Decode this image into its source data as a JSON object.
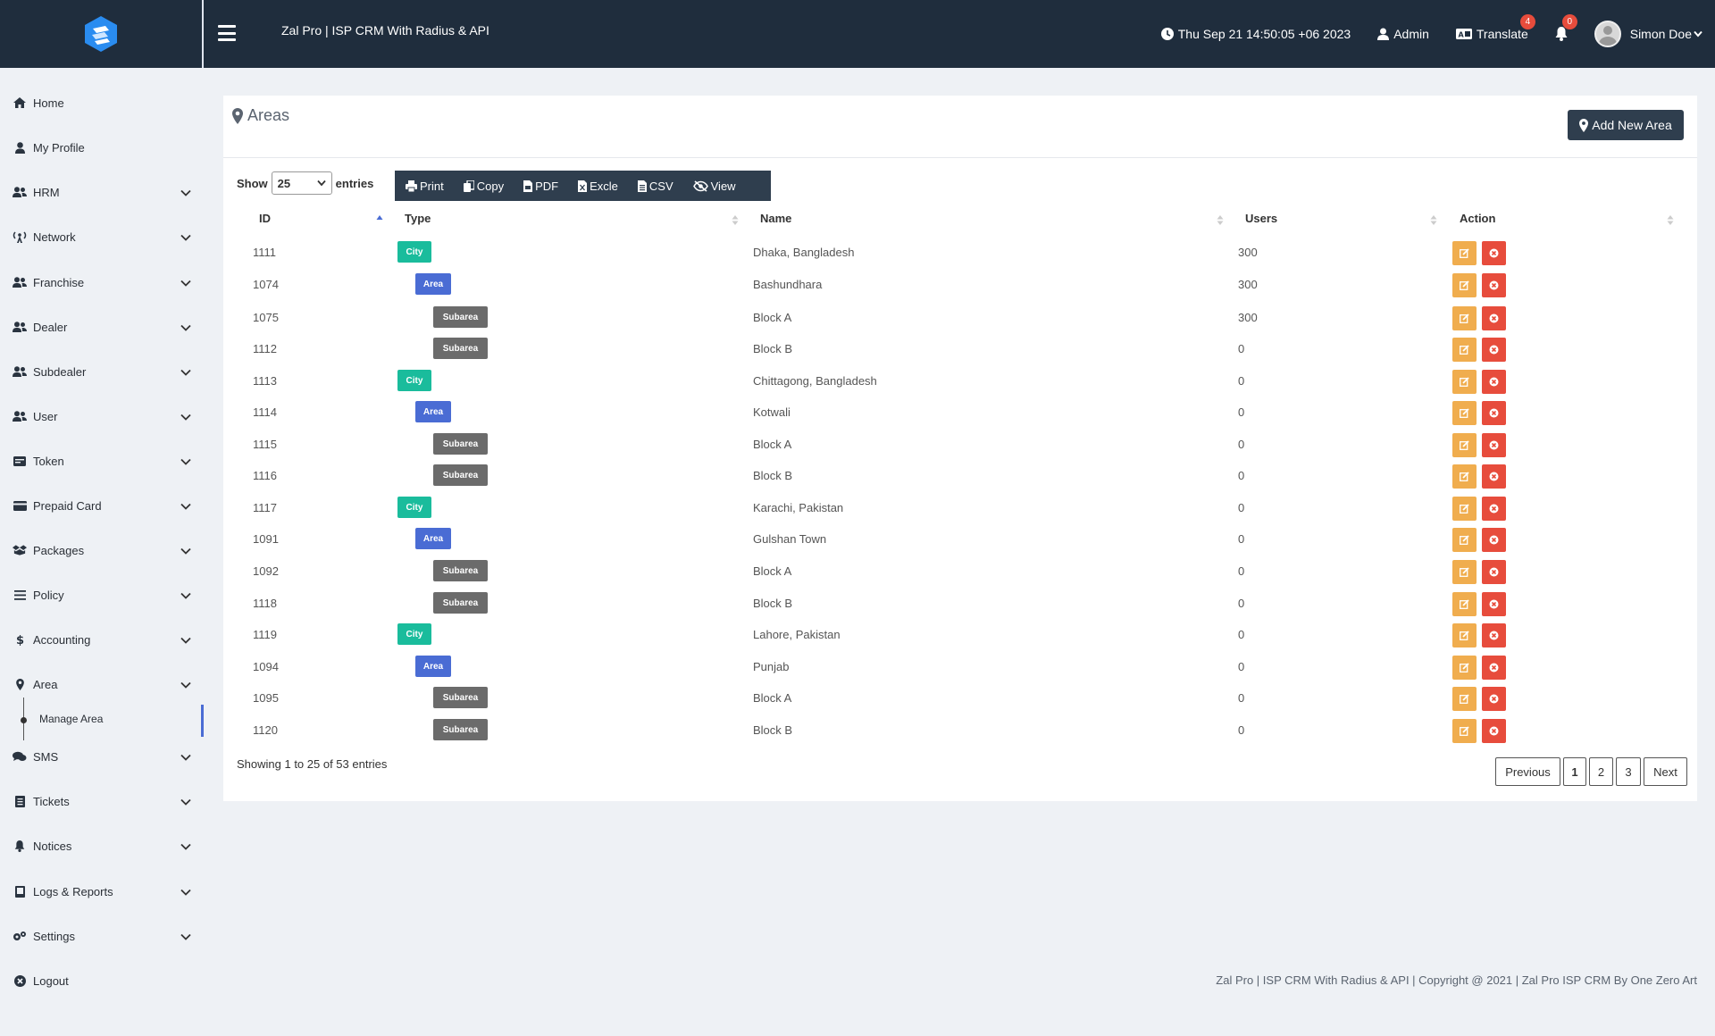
{
  "header": {
    "app_title": "Zal Pro | ISP CRM With Radius & API",
    "datetime": "Thu Sep 21 14:50:05 +06 2023",
    "admin_label": "Admin",
    "translate_label": "Translate",
    "translate_badge": "4",
    "notification_badge": "0",
    "user_name": "Simon Doe"
  },
  "sidebar": {
    "items": [
      {
        "label": "Home",
        "icon": "home-icon",
        "chevron": false
      },
      {
        "label": "My Profile",
        "icon": "user-icon",
        "chevron": false
      },
      {
        "label": "HRM",
        "icon": "users-icon",
        "chevron": true
      },
      {
        "label": "Network",
        "icon": "antenna-icon",
        "chevron": true
      },
      {
        "label": "Franchise",
        "icon": "users-icon",
        "chevron": true
      },
      {
        "label": "Dealer",
        "icon": "users-icon",
        "chevron": true
      },
      {
        "label": "Subdealer",
        "icon": "users-icon",
        "chevron": true
      },
      {
        "label": "User",
        "icon": "users-icon",
        "chevron": true
      },
      {
        "label": "Token",
        "icon": "token-icon",
        "chevron": true
      },
      {
        "label": "Prepaid Card",
        "icon": "card-icon",
        "chevron": true
      },
      {
        "label": "Packages",
        "icon": "packages-icon",
        "chevron": true
      },
      {
        "label": "Policy",
        "icon": "list-icon",
        "chevron": true
      },
      {
        "label": "Accounting",
        "icon": "dollar-icon",
        "chevron": true
      },
      {
        "label": "Area",
        "icon": "map-marker-icon",
        "chevron": true
      },
      {
        "label": "SMS",
        "icon": "comments-icon",
        "chevron": true
      },
      {
        "label": "Tickets",
        "icon": "ticket-icon",
        "chevron": true
      },
      {
        "label": "Notices",
        "icon": "bell-icon",
        "chevron": true
      },
      {
        "label": "Logs & Reports",
        "icon": "book-icon",
        "chevron": true
      },
      {
        "label": "Settings",
        "icon": "gears-icon",
        "chevron": true
      },
      {
        "label": "Logout",
        "icon": "logout-icon",
        "chevron": false
      }
    ],
    "active_sub": "Manage Area"
  },
  "page": {
    "title": "Areas",
    "add_button": "Add New Area",
    "show_label": "Show",
    "entries_label": "entries",
    "page_length": "25",
    "toolbar": [
      "Print",
      "Copy",
      "PDF",
      "Excle",
      "CSV",
      "View"
    ]
  },
  "table": {
    "headers": [
      "ID",
      "Type",
      "Name",
      "Users",
      "Action"
    ],
    "rows": [
      {
        "id": "1111",
        "type": "City",
        "name": "Dhaka, Bangladesh",
        "users": "300"
      },
      {
        "id": "1074",
        "type": "Area",
        "name": "Bashundhara",
        "users": "300"
      },
      {
        "id": "1075",
        "type": "Subarea",
        "name": "Block A",
        "users": "300"
      },
      {
        "id": "1112",
        "type": "Subarea",
        "name": "Block B",
        "users": "0"
      },
      {
        "id": "1113",
        "type": "City",
        "name": "Chittagong, Bangladesh",
        "users": "0"
      },
      {
        "id": "1114",
        "type": "Area",
        "name": "Kotwali",
        "users": "0"
      },
      {
        "id": "1115",
        "type": "Subarea",
        "name": "Block A",
        "users": "0"
      },
      {
        "id": "1116",
        "type": "Subarea",
        "name": "Block B",
        "users": "0"
      },
      {
        "id": "1117",
        "type": "City",
        "name": "Karachi, Pakistan",
        "users": "0"
      },
      {
        "id": "1091",
        "type": "Area",
        "name": "Gulshan Town",
        "users": "0"
      },
      {
        "id": "1092",
        "type": "Subarea",
        "name": "Block A",
        "users": "0"
      },
      {
        "id": "1118",
        "type": "Subarea",
        "name": "Block B",
        "users": "0"
      },
      {
        "id": "1119",
        "type": "City",
        "name": "Lahore, Pakistan",
        "users": "0"
      },
      {
        "id": "1094",
        "type": "Area",
        "name": "Punjab",
        "users": "0"
      },
      {
        "id": "1095",
        "type": "Subarea",
        "name": "Block A",
        "users": "0"
      },
      {
        "id": "1120",
        "type": "Subarea",
        "name": "Block B",
        "users": "0"
      }
    ],
    "info": "Showing 1 to 25 of 53 entries"
  },
  "pagination": {
    "previous": "Previous",
    "pages": [
      "1",
      "2",
      "3"
    ],
    "active": "1",
    "next": "Next"
  },
  "footer": {
    "text": "Zal Pro | ISP CRM With Radius & API | Copyright @ 2021 | Zal Pro ISP CRM By One Zero Art"
  },
  "colors": {
    "topbar": "#1f2d3d",
    "city_tag": "#1abc9c",
    "area_tag": "#4a6cd4",
    "subarea_tag": "#6b6b6b",
    "edit_button": "#f0ad4e",
    "delete_button": "#e74c3c"
  }
}
